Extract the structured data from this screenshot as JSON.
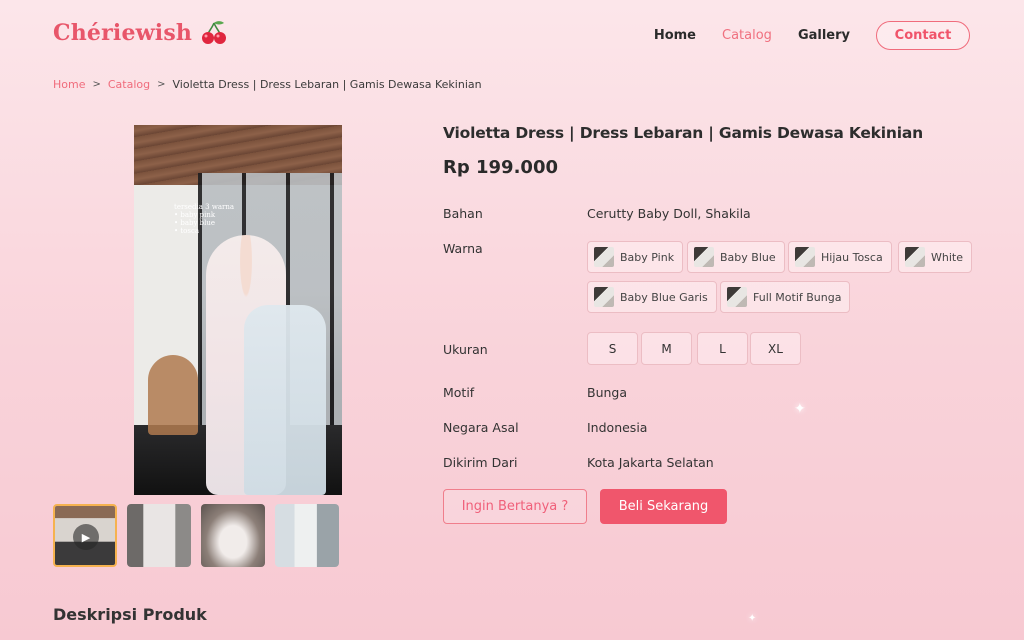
{
  "header": {
    "logo_text": "Chériewish",
    "nav": [
      {
        "label": "Home",
        "active": false
      },
      {
        "label": "Catalog",
        "active": true
      },
      {
        "label": "Gallery",
        "active": false
      }
    ],
    "contact_label": "Contact"
  },
  "breadcrumb": {
    "home": "Home",
    "catalog": "Catalog",
    "current": "Violetta Dress | Dress Lebaran | Gamis Dewasa Kekinian",
    "separator": ">"
  },
  "gallery": {
    "image_overlay_lines": [
      "tersedia 3 warna",
      "• baby pink",
      "• baby blue",
      "• tosca"
    ],
    "thumbnails": [
      {
        "kind": "video",
        "icon": "play-icon"
      },
      {
        "kind": "image"
      },
      {
        "kind": "image"
      },
      {
        "kind": "image"
      }
    ]
  },
  "product": {
    "title": "Violetta Dress | Dress Lebaran | Gamis Dewasa Kekinian",
    "price": "Rp 199.000",
    "specs": {
      "bahan": {
        "label": "Bahan",
        "value": "Cerutty Baby Doll, Shakila"
      },
      "warna": {
        "label": "Warna"
      },
      "ukuran": {
        "label": "Ukuran"
      },
      "motif": {
        "label": "Motif",
        "value": "Bunga"
      },
      "negara": {
        "label": "Negara Asal",
        "value": "Indonesia"
      },
      "dikirim": {
        "label": "Dikirim Dari",
        "value": "Kota Jakarta Selatan"
      }
    },
    "colors": [
      "Baby Pink",
      "Baby Blue",
      "Hijau Tosca",
      "White",
      "Baby Blue Garis",
      "Full Motif Bunga"
    ],
    "sizes": [
      "S",
      "M",
      "L",
      "XL"
    ]
  },
  "actions": {
    "ask_label": "Ingin Bertanya ?",
    "buy_label": "Beli Sekarang"
  },
  "description": {
    "heading": "Deskripsi Produk"
  },
  "colors_theme": {
    "accent": "#f0566c",
    "brand": "#e8566a",
    "chip_border": "#ecbdc4"
  }
}
